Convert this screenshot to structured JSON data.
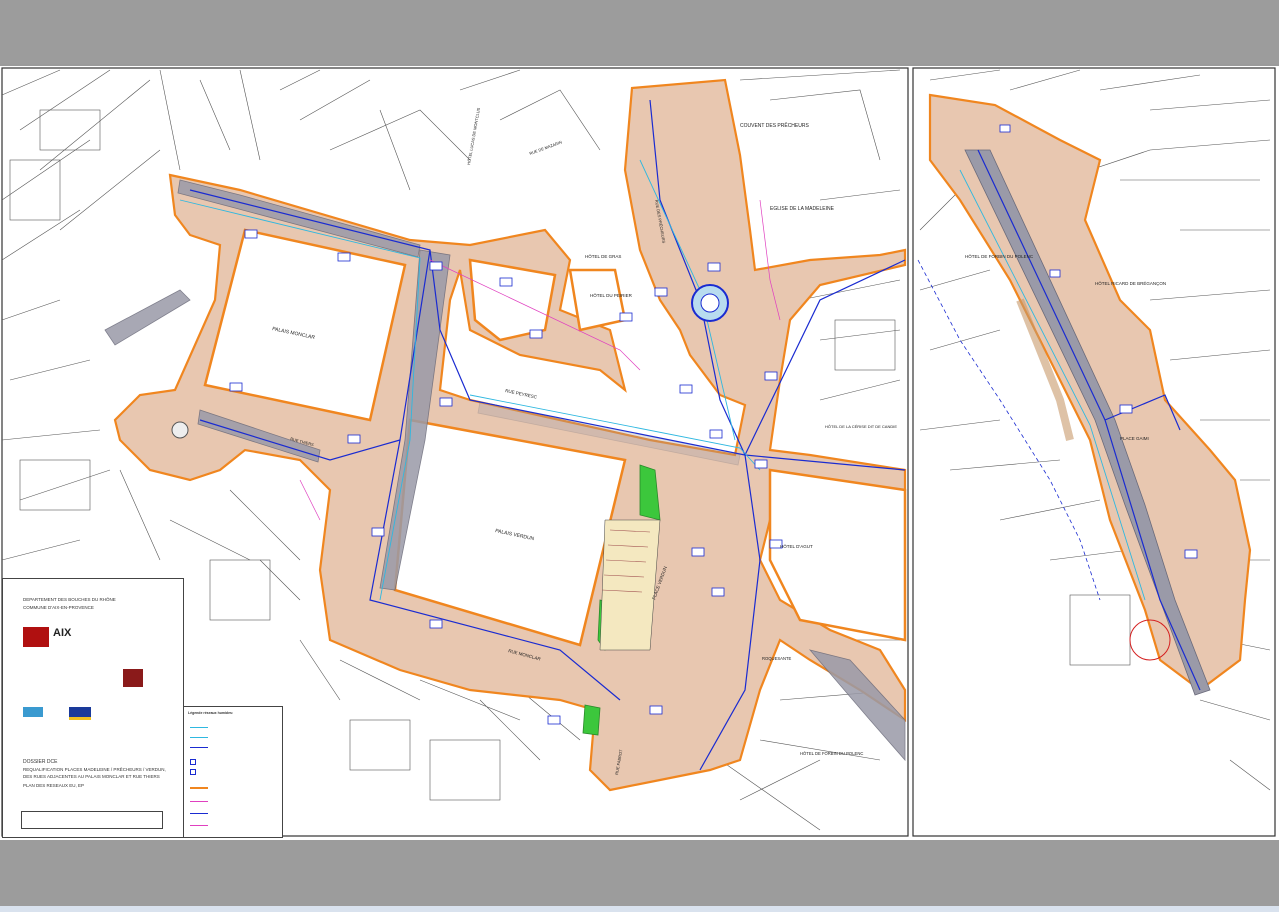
{
  "map": {
    "labels": {
      "palais_monclar": "PALAIS MONCLAR",
      "palais_verdun": "PALAIS VERDUN",
      "couvent": "COUVENT DES PRÊCHEURS",
      "eglise": "EGLISE DE LA MADELEINE",
      "hotel_gras": "HÔTEL DE GRAS",
      "hotel_peirier": "HÔTEL DU PEIRIER",
      "rue_peyresc": "RUE PEYRESC",
      "rue_mirabeau": "RUE MONCLAR",
      "place_verdun": "PLACE VERDUN",
      "hotel_agut": "HÔTEL D'AGUT",
      "hotel_ceriste": "HÔTEL DE LA CÉRISE DIT DE CANDIE",
      "hotel_forbin": "HÔTEL DE FORBIN DU POLENC",
      "roquesante": "ROQUESANTE",
      "hotel_ricard": "HÔTEL RICARD DE BRÉGANÇON",
      "place_gaimi": "PLACE GAIMI",
      "hotel_forbin_right": "HÔTEL DE FORBIN DU POLENC",
      "rue_thiers": "RUE THIERS",
      "rue_preacheurs": "RUE DES PRÊCHEURS",
      "hotel_lucas": "HÔTEL LUCAS DE MONTCLUS",
      "rue_mazarin": "RUE DE MAZARIN",
      "rue_fabrot": "RUE FABROT"
    }
  },
  "cartouche": {
    "line1": "DEPARTEMENT DES BOUCHES DU RHÔNE",
    "line2": "COMMUNE D'AIX-EN-PROVENCE",
    "logo": "AIX",
    "dossier": "DOSSIER DCE",
    "desc1": "REQUALIFICATION PLACES MADELEINE / PRÊCHEURS / VERDUN,",
    "desc2": "DES RUES ADJACENTES AU PALAIS MONCLAR ET RUE THIERS",
    "desc3": "PLAN DES RESEAUX EU, EP"
  },
  "legend": {
    "title": "Légende réseaux humides:"
  },
  "colors": {
    "bar": "#9c9c9c",
    "paving": "#e8c7b0",
    "roadway": "#9a9aa8",
    "boundary": "#f0861f",
    "network_blue": "#1a2bd1",
    "network_cyan": "#2fb8e0",
    "green": "#3cc73c",
    "magenta": "#e040c0"
  }
}
